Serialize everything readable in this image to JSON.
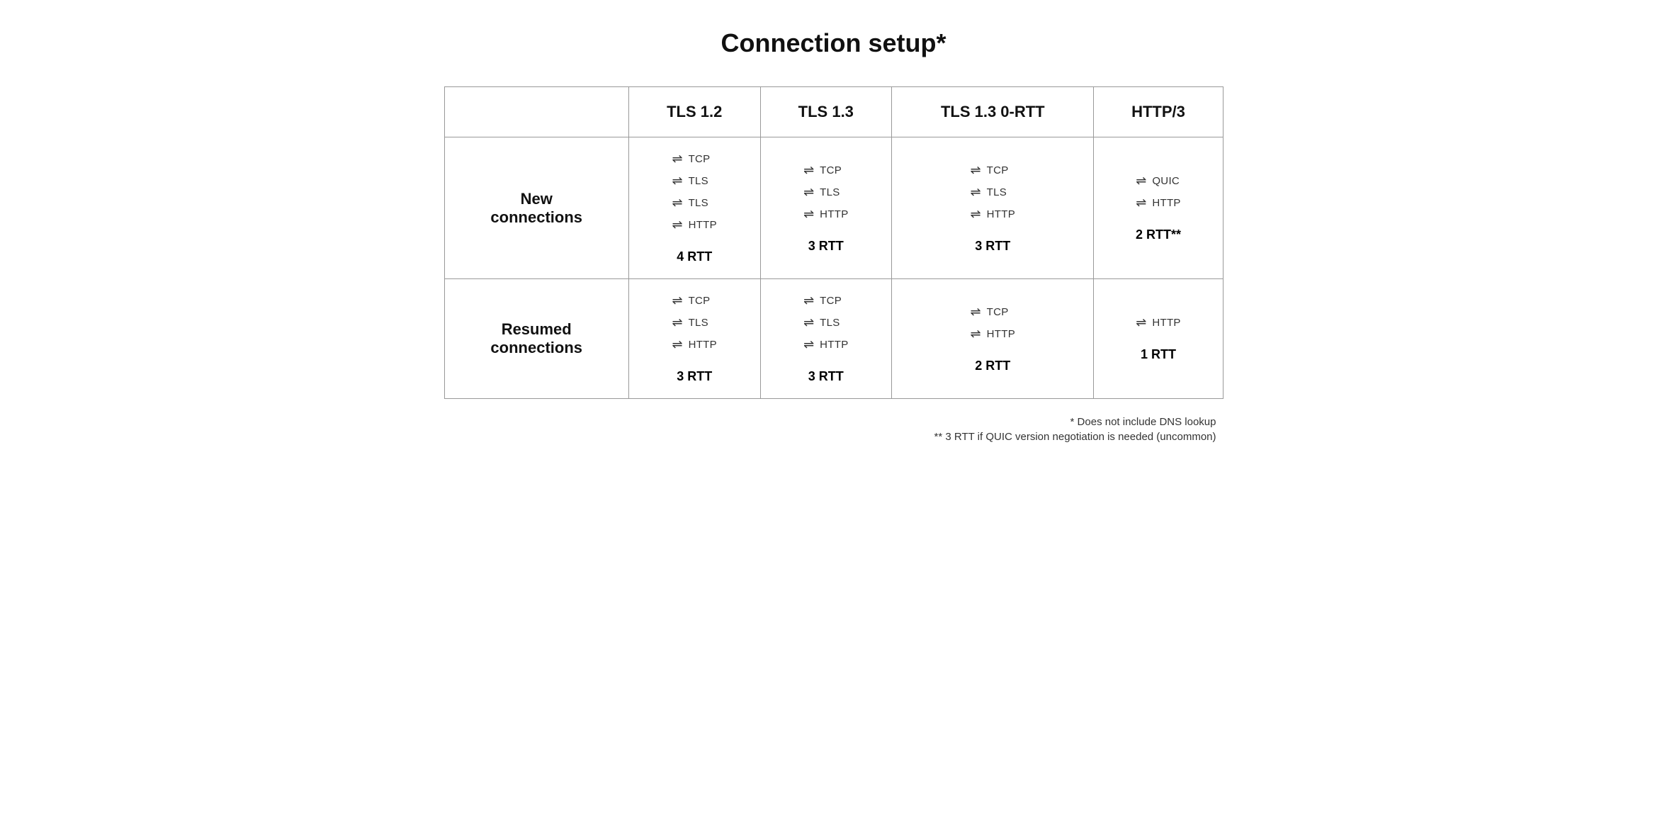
{
  "title": "Connection setup*",
  "columns": [
    {
      "id": "tls12",
      "label": "TLS 1.2"
    },
    {
      "id": "tls13",
      "label": "TLS 1.3"
    },
    {
      "id": "tls13_0rtt",
      "label": "TLS 1.3 0-RTT"
    },
    {
      "id": "http3",
      "label": "HTTP/3"
    }
  ],
  "rows": [
    {
      "id": "new",
      "label": "New\nconnections",
      "cells": [
        {
          "protocols": [
            "TCP",
            "TLS",
            "TLS",
            "HTTP"
          ],
          "rtt": "4 RTT"
        },
        {
          "protocols": [
            "TCP",
            "TLS",
            "HTTP"
          ],
          "rtt": "3 RTT"
        },
        {
          "protocols": [
            "TCP",
            "TLS",
            "HTTP"
          ],
          "rtt": "3 RTT"
        },
        {
          "protocols": [
            "QUIC",
            "HTTP"
          ],
          "rtt": "2 RTT**"
        }
      ]
    },
    {
      "id": "resumed",
      "label": "Resumed\nconnections",
      "cells": [
        {
          "protocols": [
            "TCP",
            "TLS",
            "HTTP"
          ],
          "rtt": "3 RTT"
        },
        {
          "protocols": [
            "TCP",
            "TLS",
            "HTTP"
          ],
          "rtt": "3 RTT"
        },
        {
          "protocols": [
            "TCP",
            "HTTP"
          ],
          "rtt": "2 RTT"
        },
        {
          "protocols": [
            "HTTP"
          ],
          "rtt": "1 RTT"
        }
      ]
    }
  ],
  "footnotes": [
    "* Does not include DNS lookup",
    "** 3 RTT if QUIC version negotiation is needed (uncommon)"
  ]
}
